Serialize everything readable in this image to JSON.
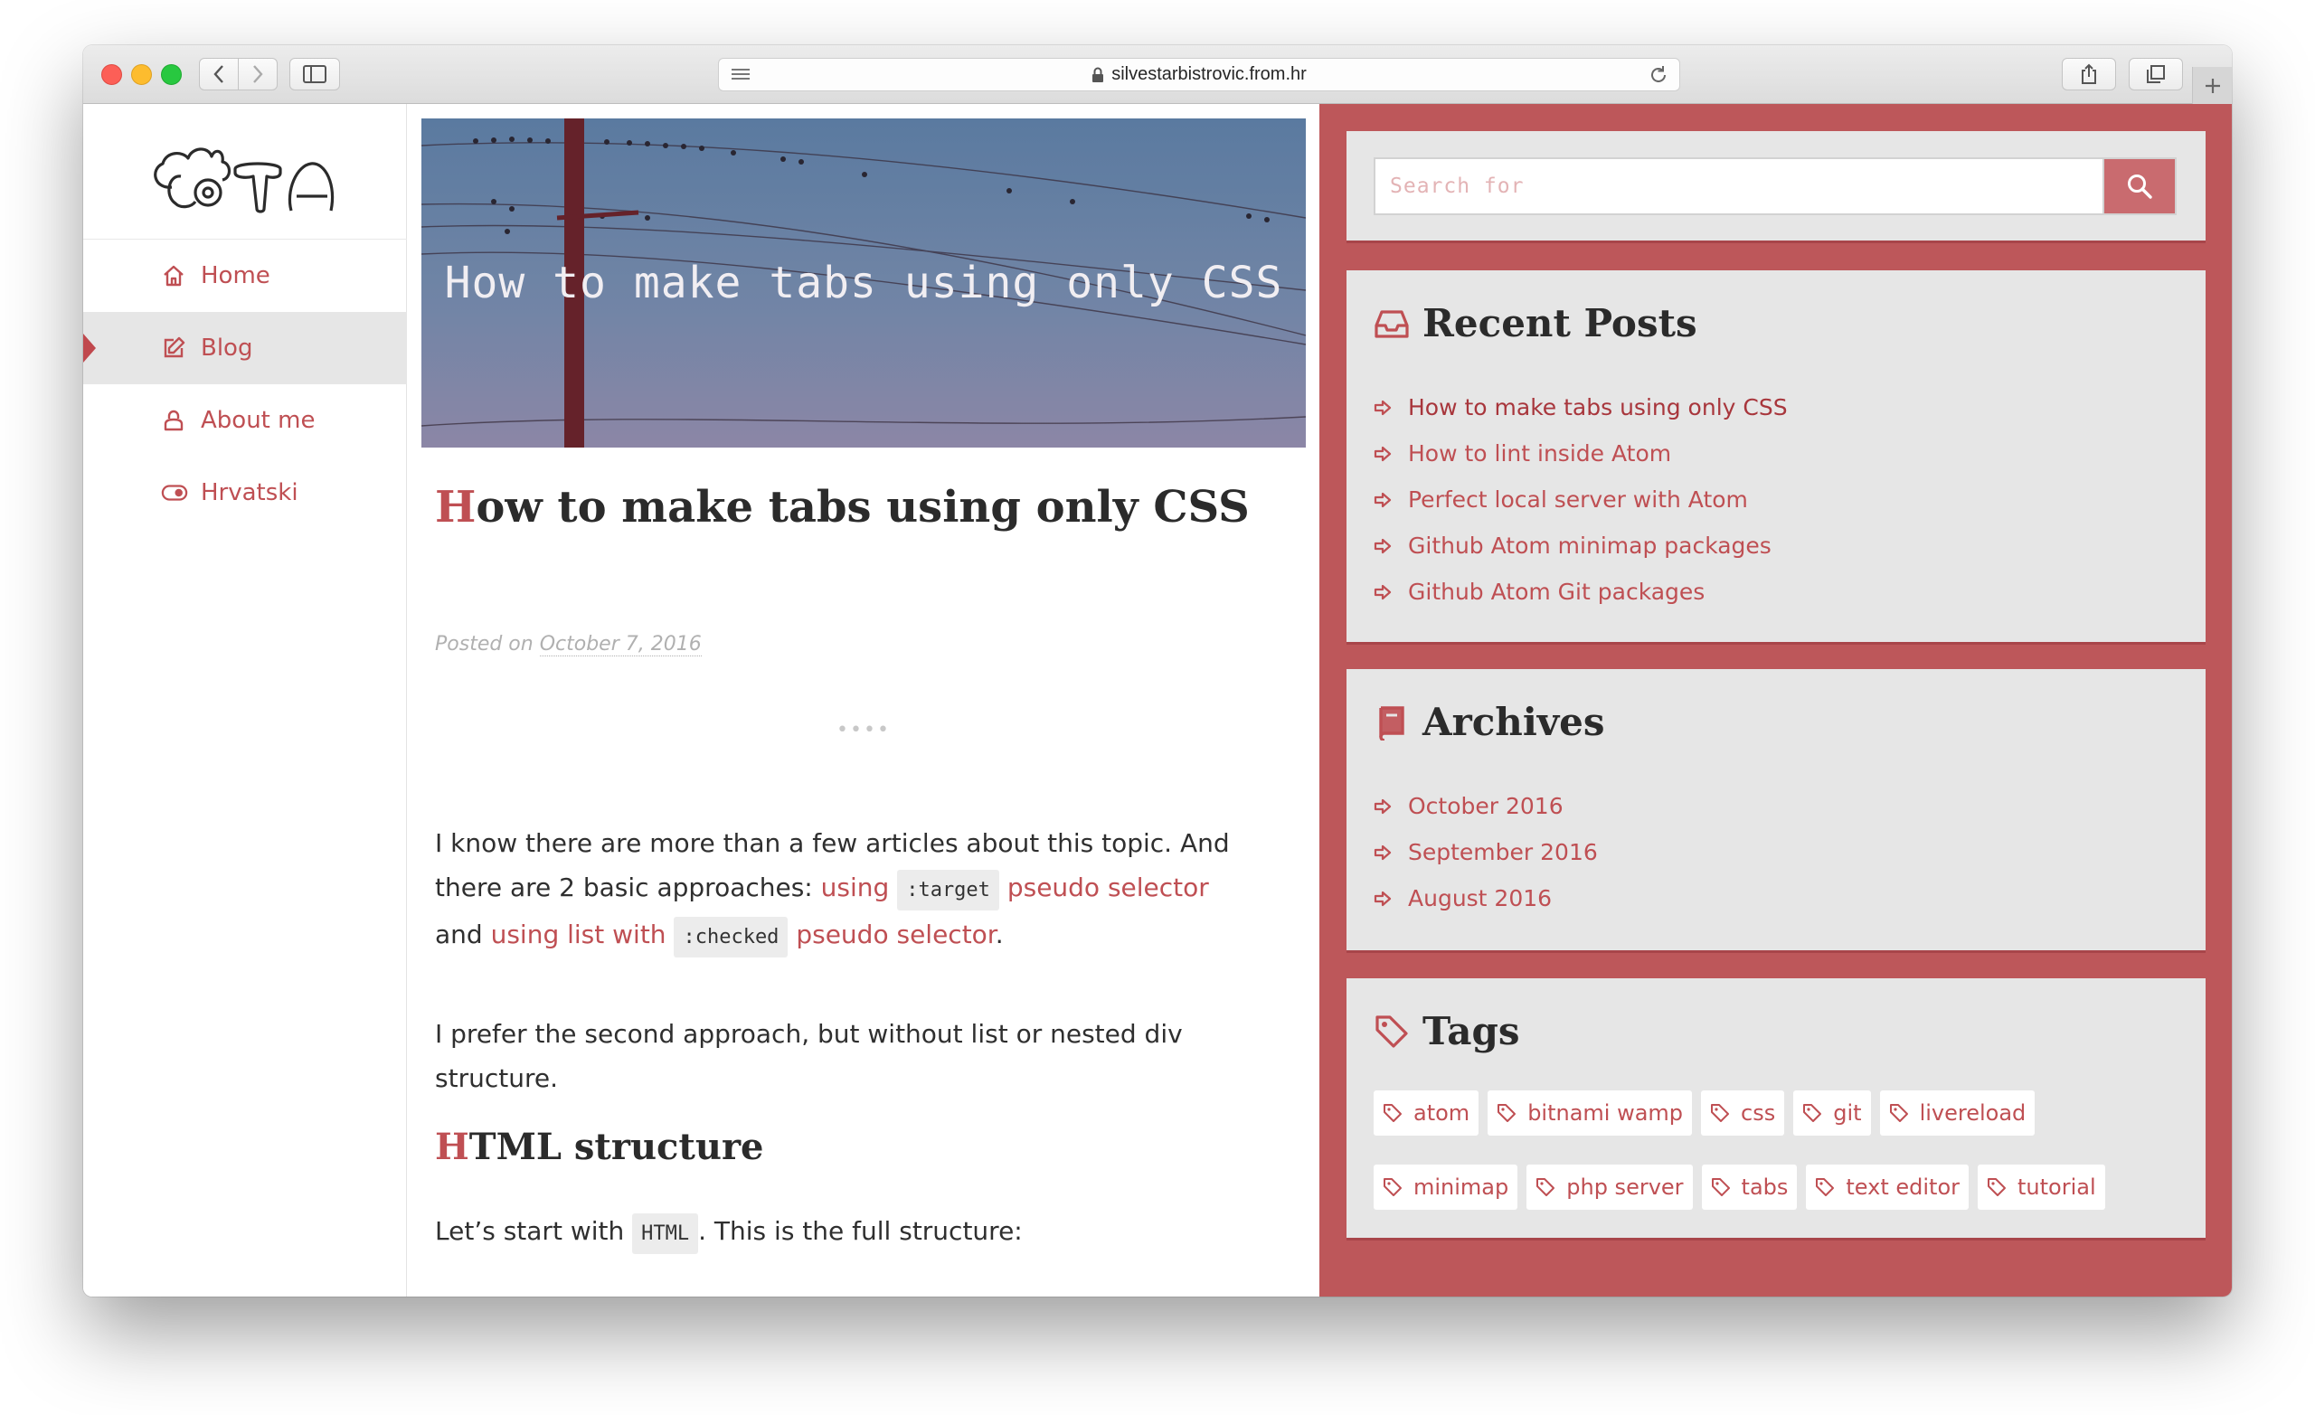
{
  "browser": {
    "url": "silvestarbistrovic.from.hr"
  },
  "nav": {
    "items": [
      {
        "label": "Home",
        "icon": "home-icon"
      },
      {
        "label": "Blog",
        "icon": "edit-icon",
        "active": true
      },
      {
        "label": "About me",
        "icon": "user-icon"
      },
      {
        "label": "Hrvatski",
        "icon": "toggle-icon"
      }
    ]
  },
  "post": {
    "hero_title": "How to make tabs using only CSS",
    "title_first": "H",
    "title_rest": "ow to make tabs using only CSS",
    "meta_prefix": "Posted on",
    "date": "October 7, 2016",
    "separator": "••••",
    "p1_a": "I know there are more than a few articles about this topic. And there are 2 basic approaches:",
    "p1_link1": "using",
    "p1_code1": ":target",
    "p1_link2": "pseudo selector",
    "p1_b": "and",
    "p1_link3": "using list with",
    "p1_code2": ":checked",
    "p1_link4": "pseudo selector",
    "p1_end": ".",
    "p2": "I prefer the second approach, but without list or nested div structure.",
    "h2_first": "H",
    "h2_rest": "TML structure",
    "p3_a": "Let’s start with",
    "p3_code": "HTML",
    "p3_b": ".  This is the full structure:"
  },
  "sidebar": {
    "search": {
      "placeholder": "Search for"
    },
    "recent": {
      "title": "Recent Posts",
      "items": [
        "How to make tabs using only CSS",
        "How to lint inside Atom",
        "Perfect local server with Atom",
        "Github Atom minimap packages",
        "Github Atom Git packages"
      ]
    },
    "archives": {
      "title": "Archives",
      "items": [
        "October 2016",
        "September 2016",
        "August 2016"
      ]
    },
    "tags": {
      "title": "Tags",
      "items": [
        "atom",
        "bitnami wamp",
        "css",
        "git",
        "livereload",
        "minimap",
        "php server",
        "tabs",
        "text editor",
        "tutorial"
      ]
    }
  },
  "colors": {
    "accent": "#bf4f53",
    "sidebar_bg": "#bd575a",
    "widget_bg": "#e6e6e6"
  }
}
